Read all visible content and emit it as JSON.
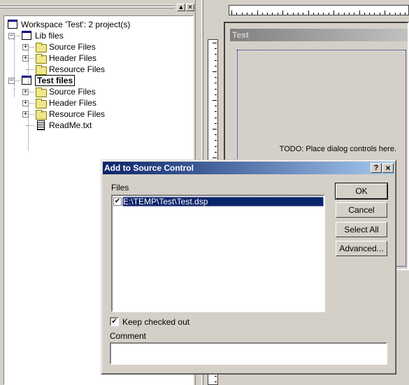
{
  "workspace_panel": {
    "tree": [
      {
        "label": "Workspace 'Test': 2 project(s)",
        "type": "workspace"
      },
      {
        "label": "Lib files",
        "type": "project",
        "expanded": true
      },
      {
        "label": "Source Files",
        "type": "folder"
      },
      {
        "label": "Header Files",
        "type": "folder"
      },
      {
        "label": "Resource Files",
        "type": "folder"
      },
      {
        "label": "Test files",
        "type": "project",
        "expanded": true,
        "active": true
      },
      {
        "label": "Source Files",
        "type": "folder"
      },
      {
        "label": "Header Files",
        "type": "folder"
      },
      {
        "label": "Resource Files",
        "type": "folder"
      },
      {
        "label": "ReadMe.txt",
        "type": "file"
      }
    ]
  },
  "editor": {
    "dialog_title": "Test",
    "todo_text": "TODO: Place dialog controls here."
  },
  "modal": {
    "title": "Add to Source Control",
    "help_label": "?",
    "close_label": "×",
    "files_label": "Files",
    "files": [
      {
        "path": "E:\\TEMP\\Test\\Test.dsp",
        "checked": true,
        "selected": true
      }
    ],
    "buttons": {
      "ok": "OK",
      "cancel": "Cancel",
      "select_all": "Select All",
      "advanced": "Advanced..."
    },
    "keep_checked_out": {
      "label": "Keep checked out",
      "checked": true
    },
    "comment_label": "Comment",
    "comment_value": ""
  },
  "colors": {
    "titlebar_start": "#0a246a",
    "titlebar_end": "#a6caf0",
    "selection": "#0a246a",
    "face": "#d4d0c8"
  }
}
